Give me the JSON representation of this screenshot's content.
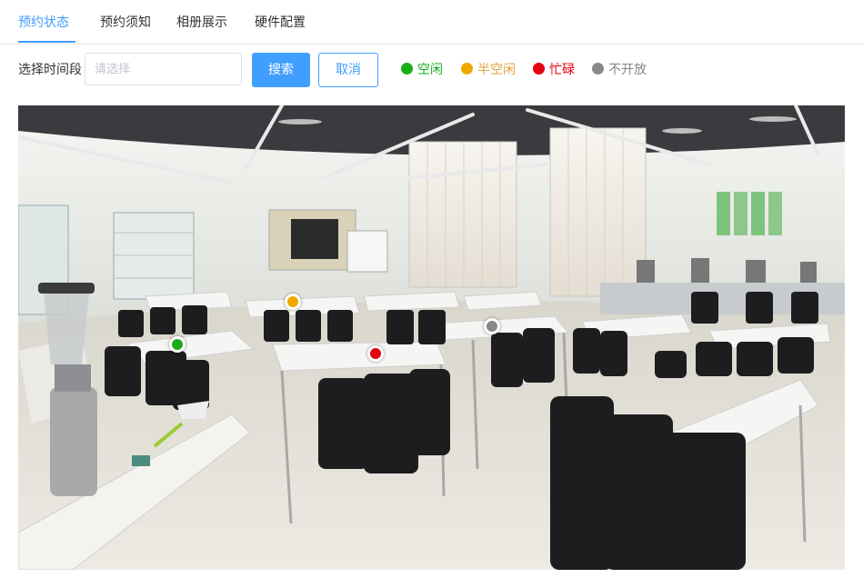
{
  "tabs": [
    {
      "label": "预约状态",
      "active": true
    },
    {
      "label": "预约须知",
      "active": false
    },
    {
      "label": "相册展示",
      "active": false
    },
    {
      "label": "硬件配置",
      "active": false
    }
  ],
  "toolbar": {
    "time_label": "选择时间段",
    "time_placeholder": "请选择",
    "search_label": "搜索",
    "cancel_label": "取消"
  },
  "legend": [
    {
      "label": "空闲",
      "color": "#1aad19",
      "text_color": "#1aad19"
    },
    {
      "label": "半空闲",
      "color": "#f0a800",
      "text_color": "#e6a23c"
    },
    {
      "label": "忙碌",
      "color": "#e60012",
      "text_color": "#e60012"
    },
    {
      "label": "不开放",
      "color": "#888888",
      "text_color": "#888888"
    }
  ],
  "room_photo": {
    "description_icon": "lab-panorama-image",
    "seat_markers": [
      {
        "status": "空闲",
        "color": "#1aad19"
      },
      {
        "status": "半空闲",
        "color": "#f0a800"
      },
      {
        "status": "忙碌",
        "color": "#e60012"
      },
      {
        "status": "不开放",
        "color": "#888888"
      }
    ]
  }
}
